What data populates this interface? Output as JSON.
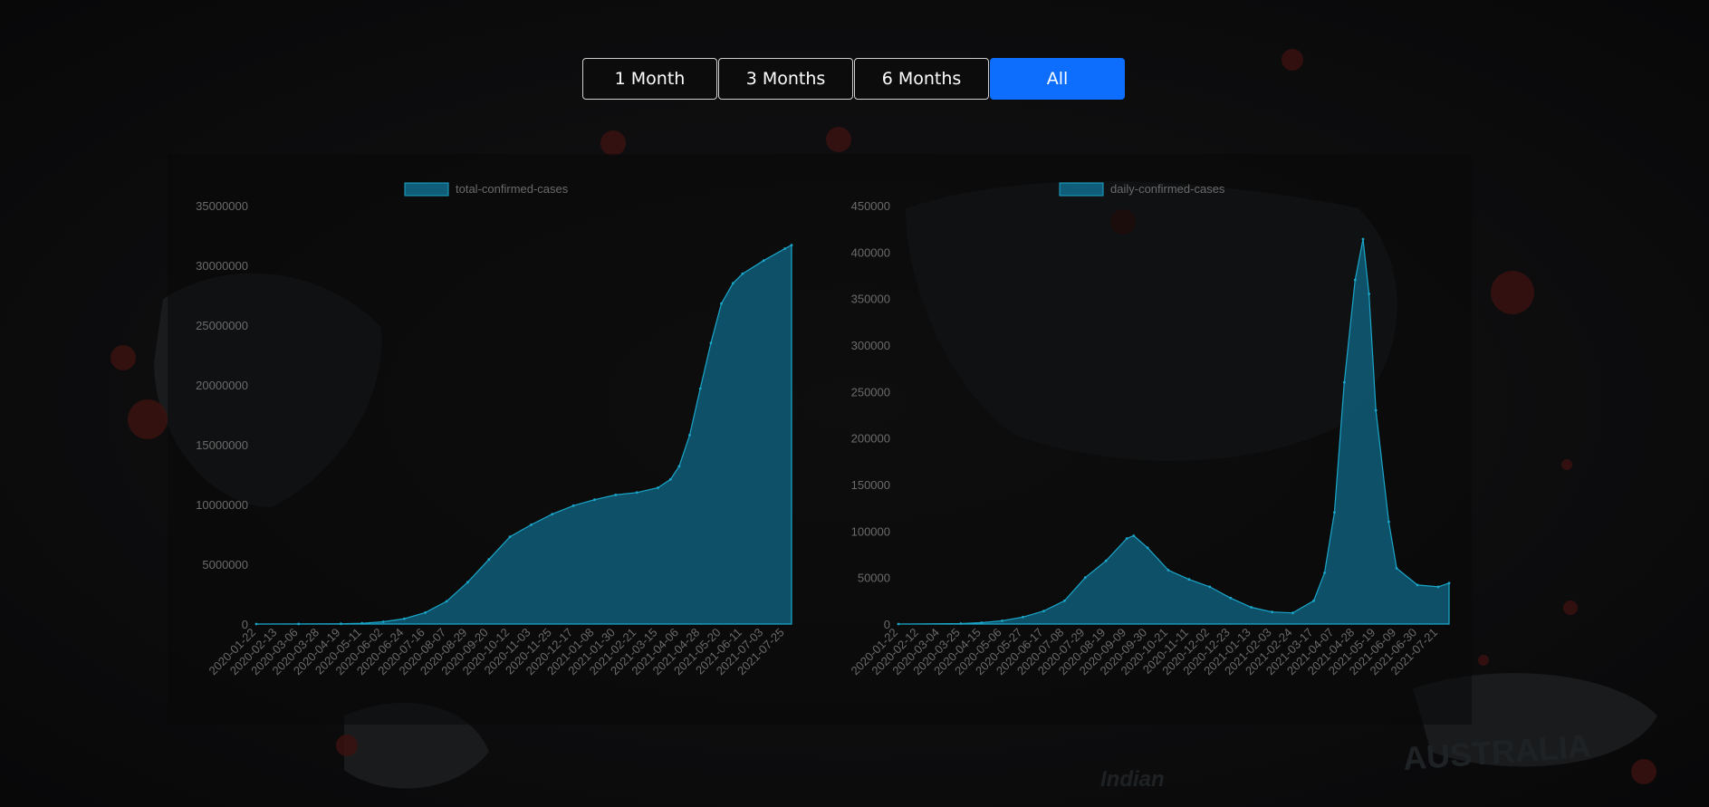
{
  "theme": {
    "accent": "#0d6efd",
    "area_fill": "#0f5d78",
    "area_stroke": "#1aa6c9",
    "text_muted": "#6b6b6b"
  },
  "range_buttons": [
    {
      "label": "1 Month",
      "active": false
    },
    {
      "label": "3 Months",
      "active": false
    },
    {
      "label": "6 Months",
      "active": false
    },
    {
      "label": "All",
      "active": true
    }
  ],
  "chart_data": [
    {
      "type": "area",
      "legend": "total-confirmed-cases",
      "ylim": [
        0,
        35000000
      ],
      "y_ticks": [
        "35000000",
        "30000000",
        "25000000",
        "20000000",
        "15000000",
        "10000000",
        "5000000",
        "0"
      ],
      "x_ticks": [
        "2020-01-22",
        "2020-02-13",
        "2020-03-06",
        "2020-03-28",
        "2020-04-19",
        "2020-05-11",
        "2020-06-02",
        "2020-06-24",
        "2020-07-16",
        "2020-08-07",
        "2020-08-29",
        "2020-09-20",
        "2020-10-12",
        "2020-11-03",
        "2020-11-25",
        "2020-12-17",
        "2021-01-08",
        "2021-01-30",
        "2021-02-21",
        "2021-03-15",
        "2021-04-06",
        "2021-04-28",
        "2021-05-20",
        "2021-06-11",
        "2021-07-03",
        "2021-07-25"
      ],
      "x": [
        "2020-01-22",
        "2020-03-06",
        "2020-04-19",
        "2020-05-11",
        "2020-06-02",
        "2020-06-24",
        "2020-07-16",
        "2020-08-07",
        "2020-08-29",
        "2020-09-20",
        "2020-10-12",
        "2020-11-03",
        "2020-11-25",
        "2020-12-17",
        "2021-01-08",
        "2021-01-30",
        "2021-02-21",
        "2021-03-15",
        "2021-03-28",
        "2021-04-06",
        "2021-04-17",
        "2021-04-28",
        "2021-05-09",
        "2021-05-20",
        "2021-06-01",
        "2021-06-11",
        "2021-07-03",
        "2021-07-25",
        "2021-08-01"
      ],
      "values": [
        0,
        10000,
        20000,
        60000,
        190000,
        450000,
        960000,
        1900000,
        3500000,
        5400000,
        7300000,
        8300000,
        9200000,
        9900000,
        10400000,
        10800000,
        11000000,
        11400000,
        12100000,
        13200000,
        15800000,
        19700000,
        23500000,
        26800000,
        28500000,
        29300000,
        30400000,
        31400000,
        31700000
      ]
    },
    {
      "type": "area",
      "legend": "daily-confirmed-cases",
      "ylim": [
        0,
        450000
      ],
      "y_ticks": [
        "450000",
        "400000",
        "350000",
        "300000",
        "250000",
        "200000",
        "150000",
        "100000",
        "50000",
        "0"
      ],
      "x_ticks": [
        "2020-01-22",
        "2020-02-12",
        "2020-03-04",
        "2020-03-25",
        "2020-04-15",
        "2020-05-06",
        "2020-05-27",
        "2020-06-17",
        "2020-07-08",
        "2020-07-29",
        "2020-08-19",
        "2020-09-09",
        "2020-09-30",
        "2020-10-21",
        "2020-11-11",
        "2020-12-02",
        "2020-12-23",
        "2021-01-13",
        "2021-02-03",
        "2021-02-24",
        "2021-03-17",
        "2021-04-07",
        "2021-04-28",
        "2021-05-19",
        "2021-06-09",
        "2021-06-30",
        "2021-07-21"
      ],
      "x": [
        "2020-01-22",
        "2020-03-25",
        "2020-04-15",
        "2020-05-06",
        "2020-05-27",
        "2020-06-17",
        "2020-07-08",
        "2020-07-29",
        "2020-08-19",
        "2020-09-09",
        "2020-09-16",
        "2020-09-30",
        "2020-10-21",
        "2020-11-11",
        "2020-12-02",
        "2020-12-23",
        "2021-01-13",
        "2021-02-03",
        "2021-02-24",
        "2021-03-17",
        "2021-03-28",
        "2021-04-07",
        "2021-04-17",
        "2021-04-28",
        "2021-05-06",
        "2021-05-12",
        "2021-05-19",
        "2021-06-01",
        "2021-06-09",
        "2021-06-30",
        "2021-07-21",
        "2021-08-01"
      ],
      "values": [
        0,
        500,
        1500,
        3500,
        7500,
        14000,
        25000,
        50000,
        68000,
        92000,
        95000,
        82000,
        58000,
        48000,
        40000,
        28000,
        18000,
        13000,
        12000,
        25000,
        55000,
        120000,
        260000,
        370000,
        414000,
        355000,
        230000,
        110000,
        60000,
        42000,
        40000,
        44000
      ]
    }
  ]
}
